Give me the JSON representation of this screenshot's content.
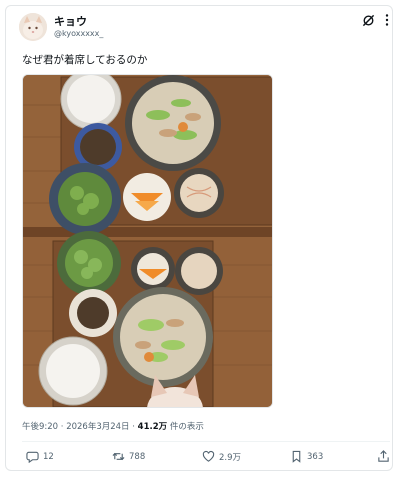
{
  "tweet": {
    "display_name": "キョウ",
    "handle": "@kyoxxxxx_",
    "text": "なぜ君が着席しておるのか",
    "time": "午後9:20",
    "separator": "·",
    "date": "2026年3月24日",
    "views_count": "41.2万",
    "views_suffix": "件の表示"
  },
  "icons": {
    "header": [
      "grok-icon",
      "more-icon"
    ],
    "actions": [
      "reply-icon",
      "retweet-icon",
      "like-icon",
      "bookmark-icon",
      "share-icon"
    ]
  },
  "actions": {
    "replies": "12",
    "retweets": "788",
    "likes": "2.9万",
    "bookmarks": "363"
  },
  "colors": {
    "text": "#0f1419",
    "secondary": "#536471",
    "border": "#e3e6e8",
    "wood": "#8a5a34"
  }
}
